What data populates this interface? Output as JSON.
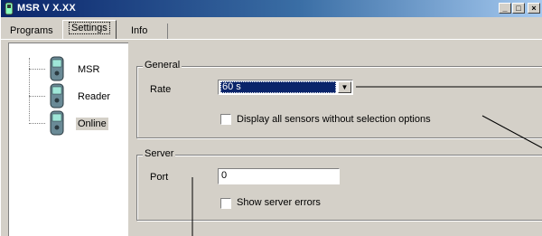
{
  "window": {
    "title": "MSR V X.XX",
    "controls": {
      "minimize": "_",
      "maximize": "□",
      "close": "×"
    }
  },
  "tabs": [
    {
      "label": "Programs",
      "active": false
    },
    {
      "label": "Settings",
      "active": true
    },
    {
      "label": "Info",
      "active": false
    }
  ],
  "tree": {
    "items": [
      {
        "label": "MSR",
        "icon": "device-icon",
        "selected": false
      },
      {
        "label": "Reader",
        "icon": "device-icon",
        "selected": false
      },
      {
        "label": "Online",
        "icon": "device-icon",
        "selected": true
      }
    ]
  },
  "general": {
    "title": "General",
    "rate_label": "Rate",
    "rate_value": "60 s",
    "display_all_label": "Display all sensors without selection options",
    "display_all_checked": false
  },
  "server": {
    "title": "Server",
    "port_label": "Port",
    "port_value": "0",
    "show_errors_label": "Show server errors",
    "show_errors_checked": false
  },
  "colors": {
    "titlebar_start": "#0a246a",
    "titlebar_end": "#a6caf0",
    "face": "#d4d0c8",
    "selection": "#0a246a"
  }
}
